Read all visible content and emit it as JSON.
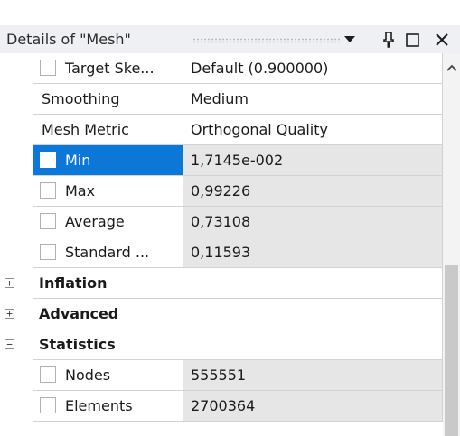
{
  "panel": {
    "title": "Details of \"Mesh\""
  },
  "icons": {
    "dropdown": "chevron-down-icon",
    "pin": "pin-icon",
    "maximize": "maximize-icon",
    "close": "close-icon",
    "scroll_up": "chevron-up-icon",
    "expand": "plus-box-icon",
    "collapse": "minus-box-icon"
  },
  "rows": [
    {
      "label": "Target Ske...",
      "value": "Default (0.900000)"
    },
    {
      "label": "Smoothing",
      "value": "Medium"
    },
    {
      "label": "Mesh Metric",
      "value": "Orthogonal Quality"
    },
    {
      "label": "Min",
      "value": "1,7145e-002"
    },
    {
      "label": "Max",
      "value": "0,99226"
    },
    {
      "label": "Average",
      "value": "0,73108"
    },
    {
      "label": "Standard ...",
      "value": "0,11593"
    }
  ],
  "groups": [
    {
      "label": "Inflation",
      "expander": "+"
    },
    {
      "label": "Advanced",
      "expander": "+"
    },
    {
      "label": "Statistics",
      "expander": "−"
    }
  ],
  "statistics": [
    {
      "label": "Nodes",
      "value": "555551"
    },
    {
      "label": "Elements",
      "value": "2700364"
    }
  ],
  "colors": {
    "selection": "#0b78d7",
    "readonly_cell": "#e6e6e6",
    "grid_line": "#cfd3d8"
  }
}
